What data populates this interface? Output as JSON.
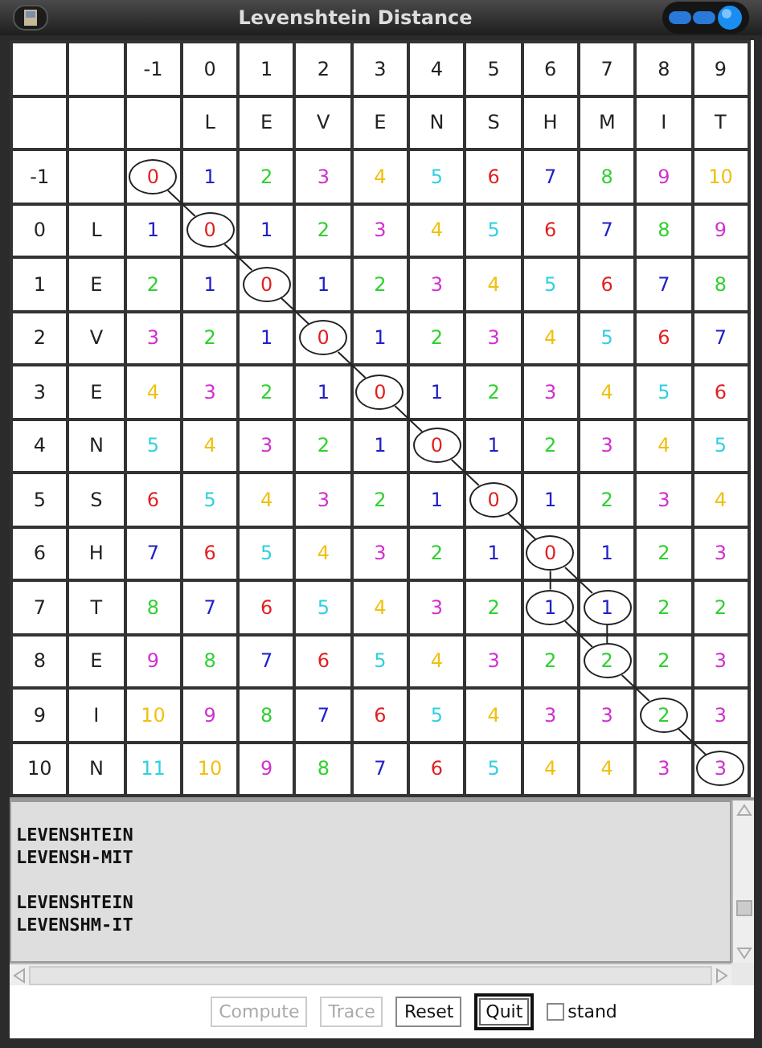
{
  "window": {
    "title": "Levenshtein Distance"
  },
  "grid": {
    "column_indices": [
      "-1",
      "0",
      "1",
      "2",
      "3",
      "4",
      "5",
      "6",
      "7",
      "8",
      "9"
    ],
    "column_letters": [
      "L",
      "E",
      "V",
      "E",
      "N",
      "S",
      "H",
      "M",
      "I",
      "T"
    ],
    "rows": [
      {
        "index": "-1",
        "cells": [
          {
            "value": "0",
            "color": "#e02020",
            "circled": true
          },
          {
            "value": "1",
            "color": "#2020c8",
            "circled": false
          },
          {
            "value": "2",
            "color": "#30d030",
            "circled": false
          },
          {
            "value": "3",
            "color": "#d030d0",
            "circled": false
          },
          {
            "value": "4",
            "color": "#f0c010",
            "circled": false
          },
          {
            "value": "5",
            "color": "#30d0e0",
            "circled": false
          },
          {
            "value": "6",
            "color": "#e02020",
            "circled": false
          },
          {
            "value": "7",
            "color": "#2020c8",
            "circled": false
          },
          {
            "value": "8",
            "color": "#30d030",
            "circled": false
          },
          {
            "value": "9",
            "color": "#d030d0",
            "circled": false
          },
          {
            "value": "10",
            "color": "#f0c010",
            "circled": false
          }
        ]
      },
      {
        "index": "0",
        "letter": "L",
        "cells": [
          {
            "value": "1",
            "color": "#2020c8",
            "circled": false
          },
          {
            "value": "0",
            "color": "#e02020",
            "circled": true
          },
          {
            "value": "1",
            "color": "#2020c8",
            "circled": false
          },
          {
            "value": "2",
            "color": "#30d030",
            "circled": false
          },
          {
            "value": "3",
            "color": "#d030d0",
            "circled": false
          },
          {
            "value": "4",
            "color": "#f0c010",
            "circled": false
          },
          {
            "value": "5",
            "color": "#30d0e0",
            "circled": false
          },
          {
            "value": "6",
            "color": "#e02020",
            "circled": false
          },
          {
            "value": "7",
            "color": "#2020c8",
            "circled": false
          },
          {
            "value": "8",
            "color": "#30d030",
            "circled": false
          },
          {
            "value": "9",
            "color": "#d030d0",
            "circled": false
          }
        ]
      },
      {
        "index": "1",
        "letter": "E",
        "cells": [
          {
            "value": "2",
            "color": "#30d030",
            "circled": false
          },
          {
            "value": "1",
            "color": "#2020c8",
            "circled": false
          },
          {
            "value": "0",
            "color": "#e02020",
            "circled": true
          },
          {
            "value": "1",
            "color": "#2020c8",
            "circled": false
          },
          {
            "value": "2",
            "color": "#30d030",
            "circled": false
          },
          {
            "value": "3",
            "color": "#d030d0",
            "circled": false
          },
          {
            "value": "4",
            "color": "#f0c010",
            "circled": false
          },
          {
            "value": "5",
            "color": "#30d0e0",
            "circled": false
          },
          {
            "value": "6",
            "color": "#e02020",
            "circled": false
          },
          {
            "value": "7",
            "color": "#2020c8",
            "circled": false
          },
          {
            "value": "8",
            "color": "#30d030",
            "circled": false
          }
        ]
      },
      {
        "index": "2",
        "letter": "V",
        "cells": [
          {
            "value": "3",
            "color": "#d030d0",
            "circled": false
          },
          {
            "value": "2",
            "color": "#30d030",
            "circled": false
          },
          {
            "value": "1",
            "color": "#2020c8",
            "circled": false
          },
          {
            "value": "0",
            "color": "#e02020",
            "circled": true
          },
          {
            "value": "1",
            "color": "#2020c8",
            "circled": false
          },
          {
            "value": "2",
            "color": "#30d030",
            "circled": false
          },
          {
            "value": "3",
            "color": "#d030d0",
            "circled": false
          },
          {
            "value": "4",
            "color": "#f0c010",
            "circled": false
          },
          {
            "value": "5",
            "color": "#30d0e0",
            "circled": false
          },
          {
            "value": "6",
            "color": "#e02020",
            "circled": false
          },
          {
            "value": "7",
            "color": "#2020c8",
            "circled": false
          }
        ]
      },
      {
        "index": "3",
        "letter": "E",
        "cells": [
          {
            "value": "4",
            "color": "#f0c010",
            "circled": false
          },
          {
            "value": "3",
            "color": "#d030d0",
            "circled": false
          },
          {
            "value": "2",
            "color": "#30d030",
            "circled": false
          },
          {
            "value": "1",
            "color": "#2020c8",
            "circled": false
          },
          {
            "value": "0",
            "color": "#e02020",
            "circled": true
          },
          {
            "value": "1",
            "color": "#2020c8",
            "circled": false
          },
          {
            "value": "2",
            "color": "#30d030",
            "circled": false
          },
          {
            "value": "3",
            "color": "#d030d0",
            "circled": false
          },
          {
            "value": "4",
            "color": "#f0c010",
            "circled": false
          },
          {
            "value": "5",
            "color": "#30d0e0",
            "circled": false
          },
          {
            "value": "6",
            "color": "#e02020",
            "circled": false
          }
        ]
      },
      {
        "index": "4",
        "letter": "N",
        "cells": [
          {
            "value": "5",
            "color": "#30d0e0",
            "circled": false
          },
          {
            "value": "4",
            "color": "#f0c010",
            "circled": false
          },
          {
            "value": "3",
            "color": "#d030d0",
            "circled": false
          },
          {
            "value": "2",
            "color": "#30d030",
            "circled": false
          },
          {
            "value": "1",
            "color": "#2020c8",
            "circled": false
          },
          {
            "value": "0",
            "color": "#e02020",
            "circled": true
          },
          {
            "value": "1",
            "color": "#2020c8",
            "circled": false
          },
          {
            "value": "2",
            "color": "#30d030",
            "circled": false
          },
          {
            "value": "3",
            "color": "#d030d0",
            "circled": false
          },
          {
            "value": "4",
            "color": "#f0c010",
            "circled": false
          },
          {
            "value": "5",
            "color": "#30d0e0",
            "circled": false
          }
        ]
      },
      {
        "index": "5",
        "letter": "S",
        "cells": [
          {
            "value": "6",
            "color": "#e02020",
            "circled": false
          },
          {
            "value": "5",
            "color": "#30d0e0",
            "circled": false
          },
          {
            "value": "4",
            "color": "#f0c010",
            "circled": false
          },
          {
            "value": "3",
            "color": "#d030d0",
            "circled": false
          },
          {
            "value": "2",
            "color": "#30d030",
            "circled": false
          },
          {
            "value": "1",
            "color": "#2020c8",
            "circled": false
          },
          {
            "value": "0",
            "color": "#e02020",
            "circled": true
          },
          {
            "value": "1",
            "color": "#2020c8",
            "circled": false
          },
          {
            "value": "2",
            "color": "#30d030",
            "circled": false
          },
          {
            "value": "3",
            "color": "#d030d0",
            "circled": false
          },
          {
            "value": "4",
            "color": "#f0c010",
            "circled": false
          }
        ]
      },
      {
        "index": "6",
        "letter": "H",
        "cells": [
          {
            "value": "7",
            "color": "#2020c8",
            "circled": false
          },
          {
            "value": "6",
            "color": "#e02020",
            "circled": false
          },
          {
            "value": "5",
            "color": "#30d0e0",
            "circled": false
          },
          {
            "value": "4",
            "color": "#f0c010",
            "circled": false
          },
          {
            "value": "3",
            "color": "#d030d0",
            "circled": false
          },
          {
            "value": "2",
            "color": "#30d030",
            "circled": false
          },
          {
            "value": "1",
            "color": "#2020c8",
            "circled": false
          },
          {
            "value": "0",
            "color": "#e02020",
            "circled": true
          },
          {
            "value": "1",
            "color": "#2020c8",
            "circled": false
          },
          {
            "value": "2",
            "color": "#30d030",
            "circled": false
          },
          {
            "value": "3",
            "color": "#d030d0",
            "circled": false
          }
        ]
      },
      {
        "index": "7",
        "letter": "T",
        "cells": [
          {
            "value": "8",
            "color": "#30d030",
            "circled": false
          },
          {
            "value": "7",
            "color": "#2020c8",
            "circled": false
          },
          {
            "value": "6",
            "color": "#e02020",
            "circled": false
          },
          {
            "value": "5",
            "color": "#30d0e0",
            "circled": false
          },
          {
            "value": "4",
            "color": "#f0c010",
            "circled": false
          },
          {
            "value": "3",
            "color": "#d030d0",
            "circled": false
          },
          {
            "value": "2",
            "color": "#30d030",
            "circled": false
          },
          {
            "value": "1",
            "color": "#2020c8",
            "circled": true
          },
          {
            "value": "1",
            "color": "#2020c8",
            "circled": true
          },
          {
            "value": "2",
            "color": "#30d030",
            "circled": false
          },
          {
            "value": "2",
            "color": "#30d030",
            "circled": false
          }
        ]
      },
      {
        "index": "8",
        "letter": "E",
        "cells": [
          {
            "value": "9",
            "color": "#d030d0",
            "circled": false
          },
          {
            "value": "8",
            "color": "#30d030",
            "circled": false
          },
          {
            "value": "7",
            "color": "#2020c8",
            "circled": false
          },
          {
            "value": "6",
            "color": "#e02020",
            "circled": false
          },
          {
            "value": "5",
            "color": "#30d0e0",
            "circled": false
          },
          {
            "value": "4",
            "color": "#f0c010",
            "circled": false
          },
          {
            "value": "3",
            "color": "#d030d0",
            "circled": false
          },
          {
            "value": "2",
            "color": "#30d030",
            "circled": false
          },
          {
            "value": "2",
            "color": "#30d030",
            "circled": true
          },
          {
            "value": "2",
            "color": "#30d030",
            "circled": false
          },
          {
            "value": "3",
            "color": "#d030d0",
            "circled": false
          }
        ]
      },
      {
        "index": "9",
        "letter": "I",
        "cells": [
          {
            "value": "10",
            "color": "#f0c010",
            "circled": false
          },
          {
            "value": "9",
            "color": "#d030d0",
            "circled": false
          },
          {
            "value": "8",
            "color": "#30d030",
            "circled": false
          },
          {
            "value": "7",
            "color": "#2020c8",
            "circled": false
          },
          {
            "value": "6",
            "color": "#e02020",
            "circled": false
          },
          {
            "value": "5",
            "color": "#30d0e0",
            "circled": false
          },
          {
            "value": "4",
            "color": "#f0c010",
            "circled": false
          },
          {
            "value": "3",
            "color": "#d030d0",
            "circled": false
          },
          {
            "value": "3",
            "color": "#d030d0",
            "circled": false
          },
          {
            "value": "2",
            "color": "#30d030",
            "circled": true
          },
          {
            "value": "3",
            "color": "#d030d0",
            "circled": false
          }
        ]
      },
      {
        "index": "10",
        "letter": "N",
        "cells": [
          {
            "value": "11",
            "color": "#30d0e0",
            "circled": false
          },
          {
            "value": "10",
            "color": "#f0c010",
            "circled": false
          },
          {
            "value": "9",
            "color": "#d030d0",
            "circled": false
          },
          {
            "value": "8",
            "color": "#30d030",
            "circled": false
          },
          {
            "value": "7",
            "color": "#2020c8",
            "circled": false
          },
          {
            "value": "6",
            "color": "#e02020",
            "circled": false
          },
          {
            "value": "5",
            "color": "#30d0e0",
            "circled": false
          },
          {
            "value": "4",
            "color": "#f0c010",
            "circled": false
          },
          {
            "value": "4",
            "color": "#f0c010",
            "circled": false
          },
          {
            "value": "3",
            "color": "#d030d0",
            "circled": false
          },
          {
            "value": "3",
            "color": "#d030d0",
            "circled": true
          }
        ]
      }
    ]
  },
  "output": {
    "alignments": [
      [
        "LEVENSHTEIN",
        "LEVENSH-MIT"
      ],
      [
        "LEVENSHTEIN",
        "LEVENSHM-IT"
      ]
    ]
  },
  "buttons": [
    {
      "label": "Compute",
      "disabled": true,
      "focused": false
    },
    {
      "label": "Trace",
      "disabled": true,
      "focused": false
    },
    {
      "label": "Reset",
      "disabled": false,
      "focused": false
    },
    {
      "label": "Quit",
      "disabled": false,
      "focused": true
    }
  ],
  "checkbox": {
    "label": "stand",
    "checked": false
  }
}
